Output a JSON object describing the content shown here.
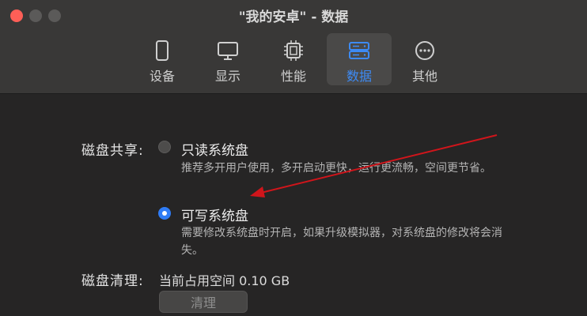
{
  "window": {
    "title": "\"我的安卓\" - 数据"
  },
  "toolbar": {
    "tabs": [
      {
        "label": "设备",
        "icon": "phone-icon"
      },
      {
        "label": "显示",
        "icon": "monitor-icon"
      },
      {
        "label": "性能",
        "icon": "chip-icon"
      },
      {
        "label": "数据",
        "icon": "storage-icon",
        "selected": true
      },
      {
        "label": "其他",
        "icon": "more-icon"
      }
    ]
  },
  "disk_sharing": {
    "label": "磁盘共享:",
    "options": [
      {
        "title": "只读系统盘",
        "description": "推荐多开用户使用，多开启动更快，运行更流畅，空间更节省。",
        "selected": false
      },
      {
        "title": "可写系统盘",
        "description": "需要修改系统盘时开启，如果升级模拟器，对系统盘的修改将会消失。",
        "selected": true
      }
    ]
  },
  "disk_cleanup": {
    "label": "磁盘清理:",
    "usage_text": "当前占用空间 0.10 GB",
    "button_label": "清理",
    "button_enabled": false
  },
  "colors": {
    "accent": "#2f7cf6",
    "annotation_arrow": "#d0151b",
    "close_button": "#fe5f57"
  }
}
